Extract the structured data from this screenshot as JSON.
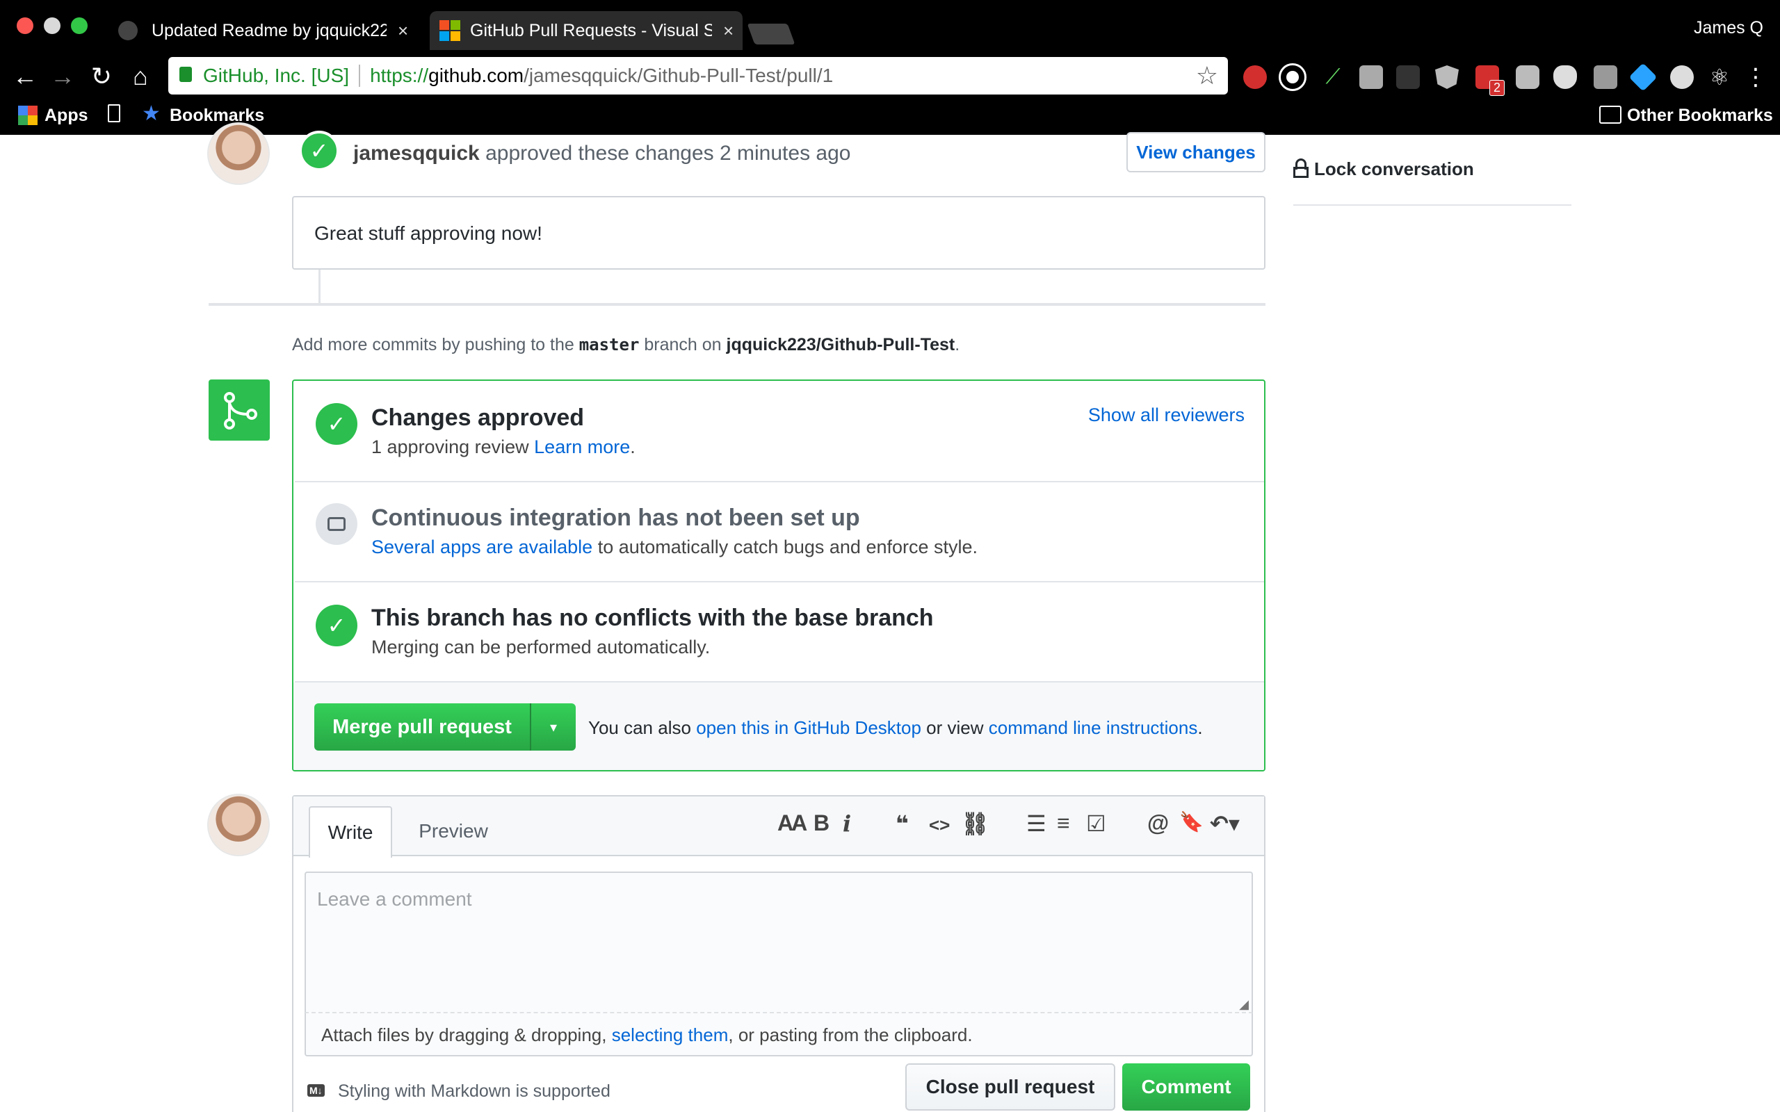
{
  "browser": {
    "tabs": [
      {
        "title": "Updated Readme by jqquick22",
        "active": false
      },
      {
        "title": "GitHub Pull Requests - Visual S",
        "active": true
      }
    ],
    "profile_name": "James Q",
    "security_label": "GitHub, Inc. [US]",
    "url_protocol": "https://",
    "url_host": "github.com",
    "url_path": "/jamesqquick/Github-Pull-Test/pull/1",
    "bookmarks": {
      "apps_label": "Apps",
      "bookmarks_label": "Bookmarks",
      "other_label": "Other Bookmarks"
    },
    "extension_badge": "2"
  },
  "review": {
    "author": "jamesqquick",
    "action_text": "approved these changes 2 minutes ago",
    "view_changes_label": "View changes",
    "comment": "Great stuff approving now!"
  },
  "sidebar": {
    "lock_label": "Lock conversation"
  },
  "push_hint": {
    "prefix": "Add more commits by pushing to the",
    "branch": "master",
    "middle": "branch on",
    "repo": "jqquick223/Github-Pull-Test",
    "suffix": "."
  },
  "mergebox": {
    "approved_title": "Changes approved",
    "approved_sub": "1 approving review",
    "learn_more": "Learn more",
    "learn_more_suffix": ".",
    "show_reviewers": "Show all reviewers",
    "ci_title": "Continuous integration has not been set up",
    "ci_link": "Several apps are available",
    "ci_rest": "to automatically catch bugs and enforce style.",
    "conflict_title": "This branch has no conflicts with the base branch",
    "conflict_sub": "Merging can be performed automatically.",
    "merge_button": "Merge pull request",
    "also_prefix": "You can also",
    "desktop_link": "open this in GitHub Desktop",
    "or_view": "or view",
    "cli_link": "command line instructions",
    "also_suffix": "."
  },
  "comment_form": {
    "tab_write": "Write",
    "tab_preview": "Preview",
    "placeholder": "Leave a comment",
    "attach_prefix": "Attach files by dragging & dropping,",
    "attach_link": "selecting them",
    "attach_suffix": ", or pasting from the clipboard.",
    "markdown_note": "Styling with Markdown is supported",
    "markdown_badge": "M↓",
    "close_button": "Close pull request",
    "comment_button": "Comment",
    "toolbar": {
      "header": "AA",
      "bold": "B",
      "italic": "i",
      "quote": "❝",
      "code": "<>",
      "link": "⛓",
      "ul": "☰",
      "ol": "≡",
      "task": "☑",
      "mention": "@",
      "reference": "🔖",
      "reply": "↶▾"
    }
  },
  "colors": {
    "accent": "#0366d6",
    "success": "#2cbe4e",
    "merge_button": "#2ea44f"
  }
}
